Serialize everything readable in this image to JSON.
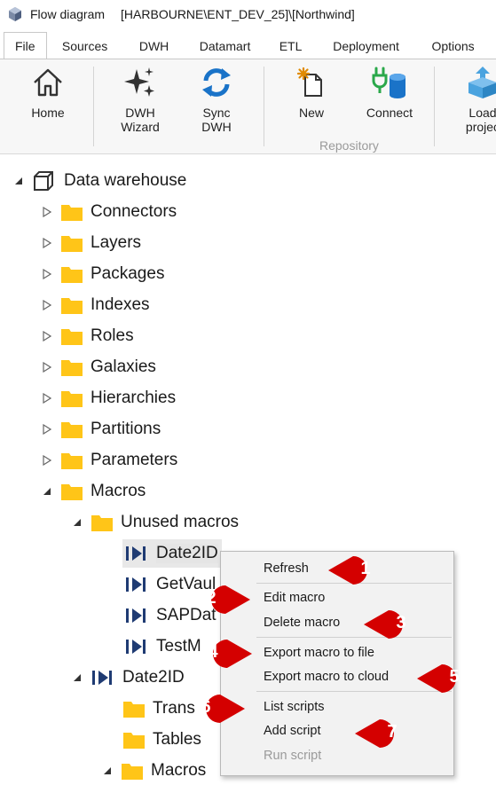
{
  "window": {
    "title": "Flow diagram",
    "connection": "[HARBOURNE\\ENT_DEV_25]\\[Northwind]"
  },
  "tabs": [
    "File",
    "Sources",
    "DWH",
    "Datamart",
    "ETL",
    "Deployment",
    "Options"
  ],
  "ribbon": {
    "home": "Home",
    "dwh_wizard": [
      "DWH",
      "Wizard"
    ],
    "sync_dwh": [
      "Sync",
      "DWH"
    ],
    "new": "New",
    "connect": "Connect",
    "load_project": [
      "Load",
      "projec"
    ],
    "group_repository": "Repository"
  },
  "tree": {
    "root": "Data warehouse",
    "children": [
      "Connectors",
      "Layers",
      "Packages",
      "Indexes",
      "Roles",
      "Galaxies",
      "Hierarchies",
      "Partitions",
      "Parameters"
    ],
    "macros": "Macros",
    "unused_macros": "Unused macros",
    "unused_items": [
      "Date2ID",
      "GetVaul",
      "SAPDat",
      "TestM"
    ],
    "date2id": "Date2ID",
    "date2id_children": [
      "Trans",
      "Tables",
      "Macros"
    ]
  },
  "context_menu": {
    "items": [
      "Refresh",
      "Edit macro",
      "Delete macro",
      "Export macro to file",
      "Export macro to cloud",
      "List scripts",
      "Add script",
      "Run script"
    ],
    "disabled": [
      "Run script"
    ]
  },
  "callouts": [
    "1",
    "2",
    "3",
    "4",
    "5",
    "6",
    "7"
  ],
  "colors": {
    "callout": "#d40000",
    "folder": "#ffc518",
    "macro_icon": "#1f3b73",
    "accent_blue": "#1a73c8"
  }
}
